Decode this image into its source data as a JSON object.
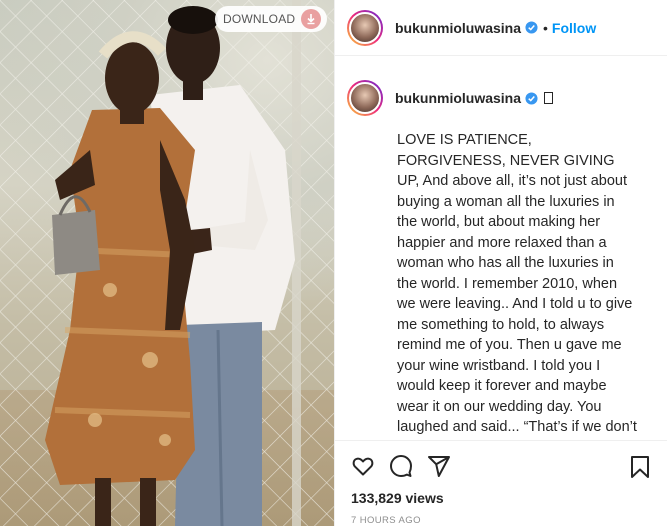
{
  "photo": {
    "download_label": "DOWNLOAD"
  },
  "header": {
    "username": "bukunmioluwasina",
    "separator": "•",
    "follow_label": "Follow"
  },
  "caption": {
    "username": "bukunmioluwasina",
    "text": "LOVE IS PATIENCE, FORGIVENESS, NEVER GIVING UP, And above all, it’s not just about buying a woman all the luxuries in the world, but about making her happier and more relaxed than a woman who has all the luxuries in the world. I remember 2010, when we were leaving.. And I told u to give me something to hold, to always remind me of you. Then u gave me your wine wristband. I told you I would keep it forever and maybe wear it on our wedding day. You laughed and said... “That’s if we don’t end up breaking up when we enter UNIVERSITY, and you start meeting better guys” It’s 11 years now, and I have met a lot of men like you"
  },
  "stats": {
    "views": "133,829 views",
    "timestamp": "7 HOURS AGO"
  },
  "colors": {
    "accent": "#0095f6",
    "verified": "#3897f0",
    "text": "#262626",
    "muted": "#8e8e8e"
  },
  "icons": [
    "download-icon",
    "verified-badge-icon",
    "heart-icon",
    "comment-icon",
    "share-icon",
    "bookmark-icon"
  ]
}
